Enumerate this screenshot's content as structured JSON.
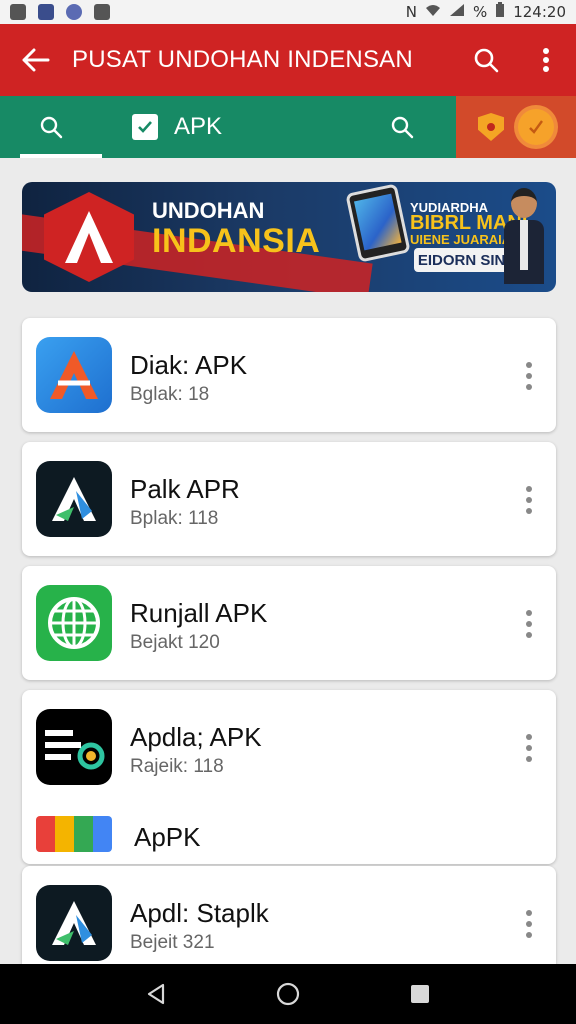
{
  "status_bar": {
    "left_icons": [
      "notification-icon",
      "image-icon",
      "chrome-icon",
      "camera-icon"
    ],
    "right_icons": [
      "nfc-icon",
      "wifi-icon",
      "signal-icon"
    ],
    "battery": "%",
    "time": "124:20"
  },
  "app_bar": {
    "title": "PUSAT UNDOHAN INDENSAN",
    "back_icon": "arrow-left-icon",
    "search_icon": "search-icon",
    "menu_icon": "overflow-menu-icon"
  },
  "tabs": {
    "apk_label": "APK",
    "promo_icons": [
      "shield-icon",
      "check-circle-icon"
    ]
  },
  "banner": {
    "line1": "UNDOHAN",
    "line2": "INDANSIA",
    "right_line1": "YUDIARDHA",
    "right_line2": "BIBRL MANI",
    "right_line3": "UIENE JUARAIAN",
    "cta": "EIDORN SINER"
  },
  "apps": [
    {
      "name": "Diak: APK",
      "size": "Bglak: 18",
      "icon": "a-logo-icon",
      "icon_colors": [
        "#2f8fe0",
        "#f05a28"
      ]
    },
    {
      "name": "Palk APR",
      "size": "Bplak: 118",
      "icon": "a-dark-logo-icon",
      "icon_colors": [
        "#0d1a22",
        "#ffffff"
      ]
    },
    {
      "name": "Runjall APK",
      "size": "Bejakt 120",
      "icon": "globe-icon",
      "icon_colors": [
        "#27b24a",
        "#ffffff"
      ]
    },
    {
      "name": "Apdla; APK",
      "size": "Rajeik: 118",
      "icon": "bam-logo-icon",
      "icon_colors": [
        "#000000",
        "#ffffff"
      ],
      "sub_item": {
        "name": "ApPK",
        "icon": "colorful-bars-icon"
      }
    },
    {
      "name": "Apdl: Staplk",
      "size": "Bejeit 321",
      "icon": "a-dark-logo-icon",
      "icon_colors": [
        "#0d1a22",
        "#ffffff"
      ]
    }
  ],
  "nav_bar": {
    "back": "back-triangle-icon",
    "home": "home-circle-icon",
    "recents": "recents-square-icon"
  }
}
